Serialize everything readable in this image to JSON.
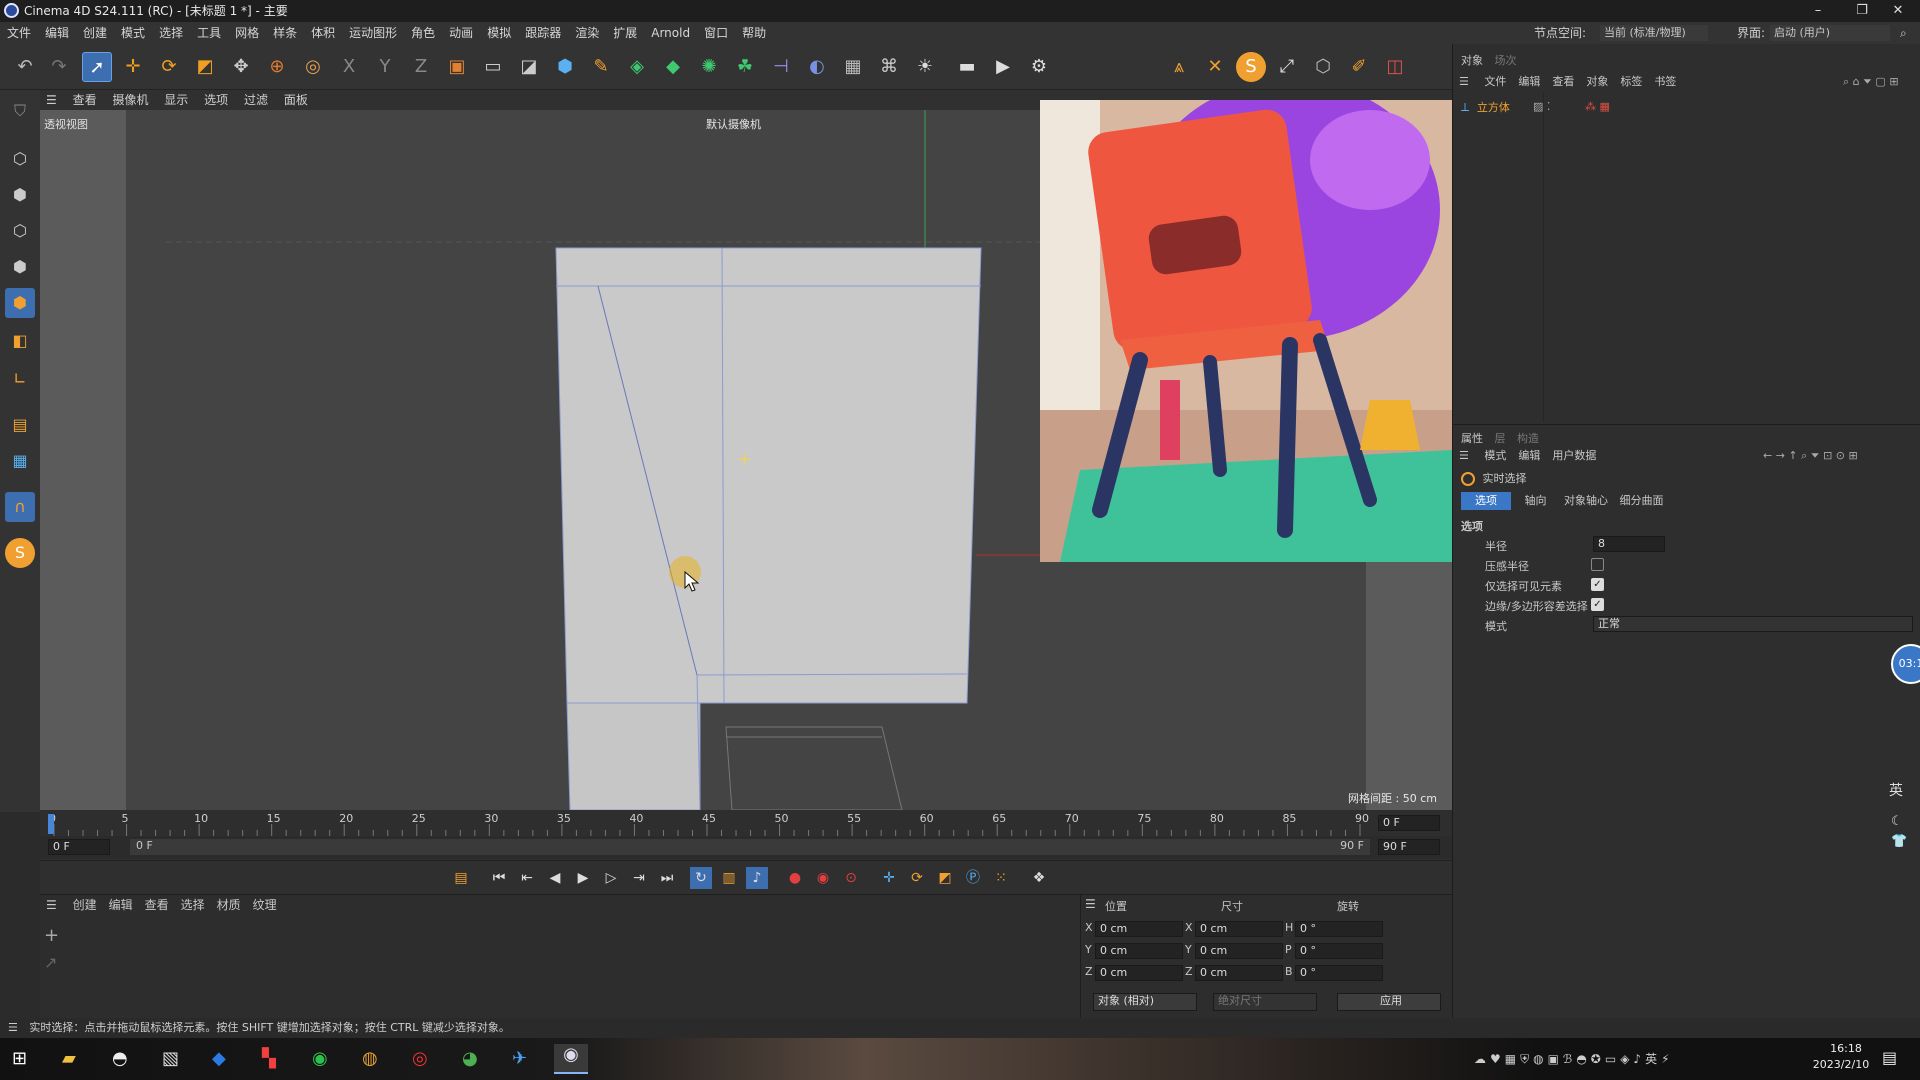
{
  "window": {
    "title": "Cinema 4D S24.111 (RC) - [未标题 1 *] - 主要",
    "minimize": "–",
    "restore": "❐",
    "close": "✕"
  },
  "menu": [
    "文件",
    "编辑",
    "创建",
    "模式",
    "选择",
    "工具",
    "网格",
    "样条",
    "体积",
    "运动图形",
    "角色",
    "动画",
    "模拟",
    "跟踪器",
    "渲染",
    "扩展",
    "Arnold",
    "窗口",
    "帮助"
  ],
  "node_space": {
    "label": "节点空间:",
    "value": "当前 (标准/物理)"
  },
  "interface": {
    "label": "界面:",
    "value": "启动 (用户)"
  },
  "viewport": {
    "menu": [
      "查看",
      "摄像机",
      "显示",
      "选项",
      "过滤",
      "面板"
    ],
    "name": "透视视图",
    "camera": "默认摄像机",
    "grid_spacing": "网格间距 : 50 cm"
  },
  "timeline": {
    "ticks": [
      "0",
      "5",
      "10",
      "15",
      "20",
      "25",
      "30",
      "35",
      "40",
      "45",
      "50",
      "55",
      "60",
      "65",
      "70",
      "75",
      "80",
      "85",
      "90"
    ],
    "current_frame": "0 F",
    "start": "0 F",
    "range_start": "0 F",
    "range_end": "90 F",
    "end": "90 F"
  },
  "material_menu": [
    "创建",
    "编辑",
    "查看",
    "选择",
    "材质",
    "纹理"
  ],
  "coords": {
    "headers": [
      "位置",
      "尺寸",
      "旋转"
    ],
    "rows": [
      {
        "a": "X",
        "pos": "0 cm",
        "b": "X",
        "size": "0 cm",
        "c": "H",
        "rot": "0 °"
      },
      {
        "a": "Y",
        "pos": "0 cm",
        "b": "Y",
        "size": "0 cm",
        "c": "P",
        "rot": "0 °"
      },
      {
        "a": "Z",
        "pos": "0 cm",
        "b": "Z",
        "size": "0 cm",
        "c": "B",
        "rot": "0 °"
      }
    ],
    "mode": "对象 (相对)",
    "size_mode": "绝对尺寸",
    "apply": "应用"
  },
  "objects_panel": {
    "tabs": [
      "对象",
      "场次"
    ],
    "menu": [
      "文件",
      "编辑",
      "查看",
      "对象",
      "标签",
      "书签"
    ],
    "item": "立方体"
  },
  "attributes": {
    "tabs": [
      "属性",
      "层",
      "构造"
    ],
    "menu": [
      "模式",
      "编辑",
      "用户数据"
    ],
    "tool": "实时选择",
    "subtabs": [
      "选项",
      "轴向",
      "对象轴心",
      "细分曲面"
    ],
    "section": "选项",
    "radius_label": "半径",
    "radius": "8",
    "pressure_label": "压感半径",
    "pressure": false,
    "visible_label": "仅选择可见元素",
    "visible": true,
    "tolerant_label": "边缘/多边形容差选择",
    "tolerant": true,
    "mode_label": "模式",
    "mode": "正常"
  },
  "side_badge": "03:1",
  "ime": {
    "lang": "英"
  },
  "status": "实时选择：点击并拖动鼠标选择元素。按住 SHIFT 键增加选择对象；按住 CTRL 键减少选择对象。",
  "clock": {
    "time": "16:18",
    "date": "2023/2/10"
  },
  "colors": {
    "accent": "#3a78c7",
    "bg": "#2b2b2b",
    "axis_y": "#4caf50",
    "axis_x": "#c0392b"
  }
}
